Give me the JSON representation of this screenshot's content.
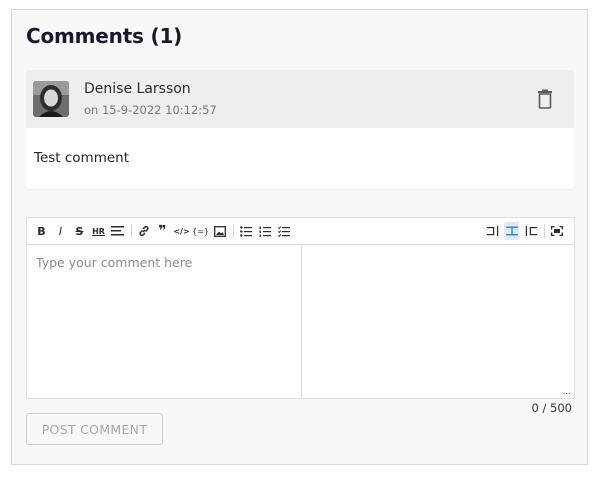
{
  "comments_section": {
    "title": "Comments (1)"
  },
  "comments": [
    {
      "author": "Denise Larsson",
      "date": "on 15-9-2022 10:12:57",
      "body": "Test comment"
    }
  ],
  "editor": {
    "placeholder": "Type your comment here",
    "counter": "0 / 500",
    "toolbar_left": [
      {
        "name": "bold",
        "glyph": "B"
      },
      {
        "name": "italic",
        "glyph": "I"
      },
      {
        "name": "strikethrough",
        "glyph": "S"
      },
      {
        "name": "horizontal-rule",
        "glyph": "HR"
      },
      {
        "name": "heading",
        "glyph": "H"
      },
      {
        "name": "link",
        "glyph": "🔗"
      },
      {
        "name": "quote",
        "glyph": "❞"
      },
      {
        "name": "code",
        "glyph": "</>"
      },
      {
        "name": "variable",
        "glyph": "{=}"
      },
      {
        "name": "image",
        "glyph": "🖼"
      },
      {
        "name": "bullet-list",
        "glyph": "•≡"
      },
      {
        "name": "numbered-list",
        "glyph": "1≡"
      },
      {
        "name": "checklist",
        "glyph": "☑≡"
      }
    ],
    "toolbar_right": [
      {
        "name": "edit-mode"
      },
      {
        "name": "split-mode"
      },
      {
        "name": "preview-mode"
      },
      {
        "name": "fullscreen"
      }
    ],
    "resize_handle": "..."
  },
  "actions": {
    "post_label": "POST COMMENT"
  }
}
